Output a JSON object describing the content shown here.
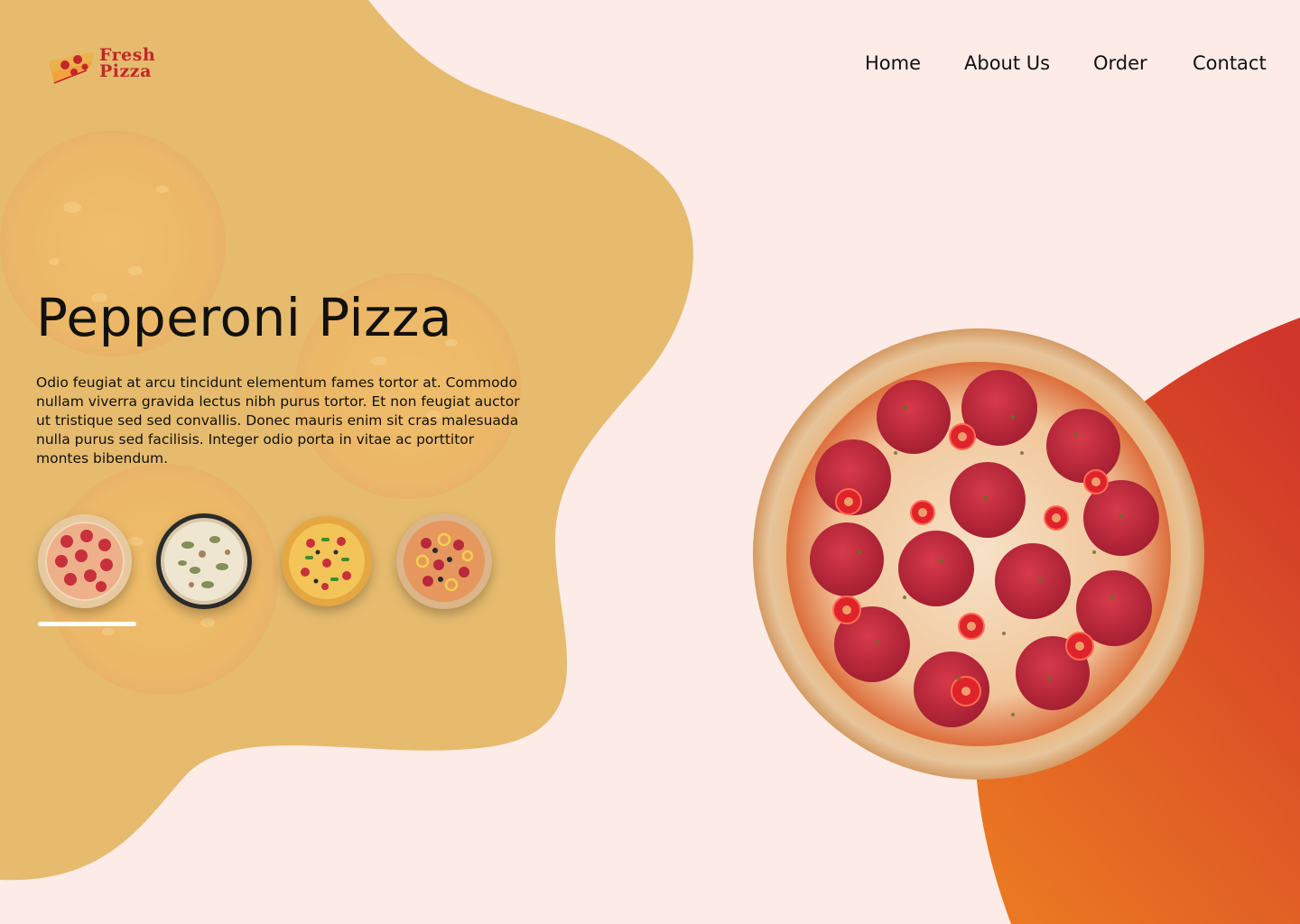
{
  "brand": {
    "line1": "Fresh",
    "line2": "Pizza",
    "logo_icon": "pizza-slice-icon"
  },
  "nav": {
    "items": [
      {
        "label": "Home"
      },
      {
        "label": "About Us"
      },
      {
        "label": "Order"
      },
      {
        "label": "Contact"
      }
    ]
  },
  "hero": {
    "title": "Pepperoni Pizza",
    "description": "Odio feugiat at arcu tincidunt elementum fames tortor at. Commodo nullam viverra gravida lectus nibh purus tortor. Et non feugiat auctor ut tristique sed sed convallis. Donec mauris enim sit cras malesuada nulla purus sed facilisis. Integer odio porta in vitae ac porttitor montes bibendum."
  },
  "carousel": {
    "items": [
      {
        "name": "pepperoni-pizza-thumb",
        "active": true
      },
      {
        "name": "mushroom-pizza-thumb",
        "active": false
      },
      {
        "name": "veggie-pizza-thumb",
        "active": false
      },
      {
        "name": "supreme-pizza-thumb",
        "active": false
      }
    ],
    "active_index": 0
  },
  "colors": {
    "background": "#fcebe6",
    "blob": "#e6bb6e",
    "accent_gradient_top": "#d1362a",
    "accent_gradient_bottom": "#ea7722",
    "brand_red": "#c3262b"
  }
}
